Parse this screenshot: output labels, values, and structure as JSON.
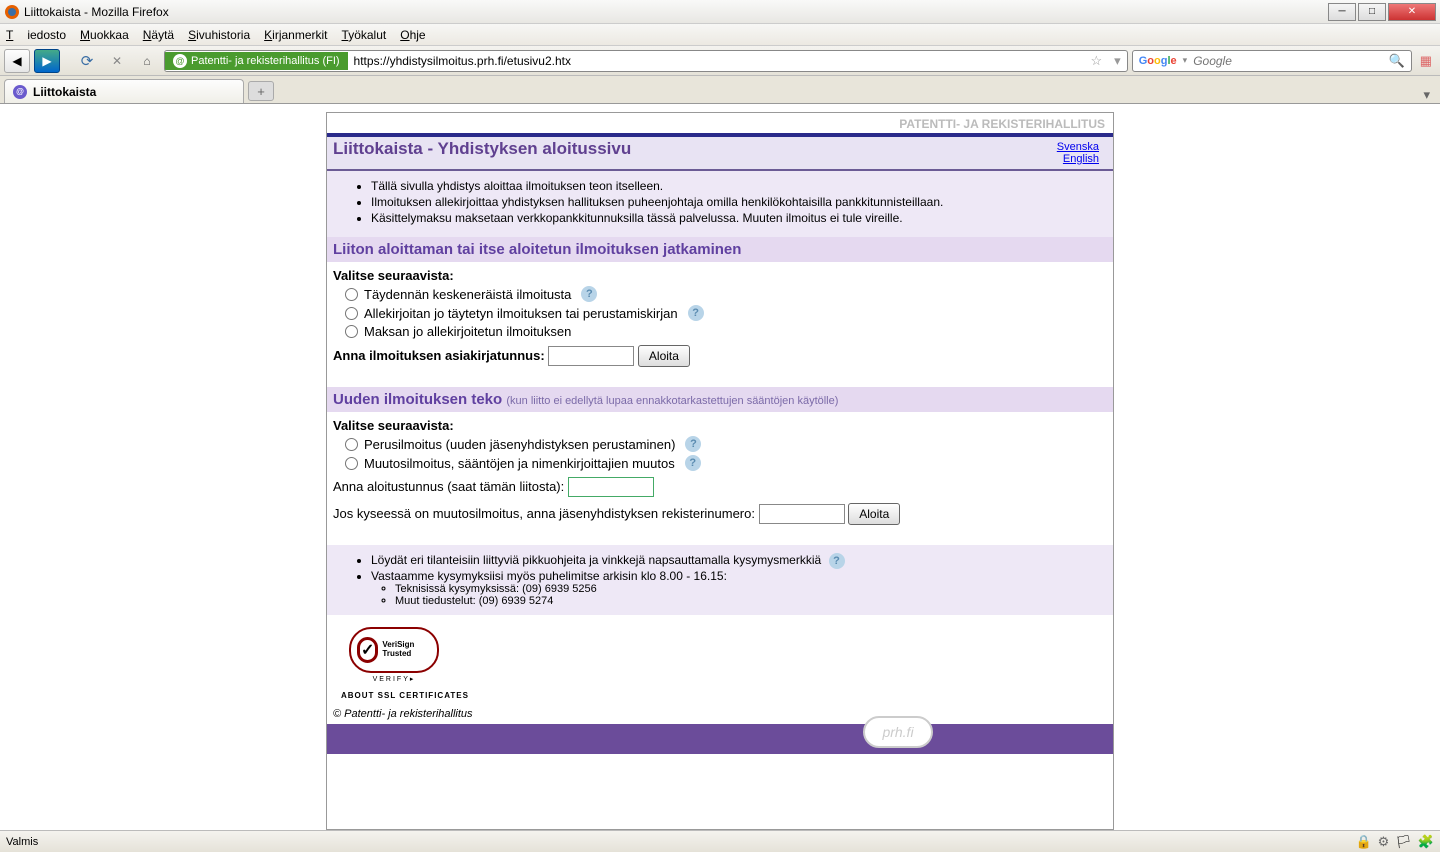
{
  "window": {
    "title": "Liittokaista - Mozilla Firefox"
  },
  "menu": {
    "items": [
      "Tiedosto",
      "Muokkaa",
      "Näytä",
      "Sivuhistoria",
      "Kirjanmerkit",
      "Työkalut",
      "Ohje"
    ]
  },
  "urlbar": {
    "identity": "Patentti- ja rekisterihallitus (FI)",
    "url": "https://yhdistysilmoitus.prh.fi/etusivu2.htx"
  },
  "searchbox": {
    "placeholder": "Google"
  },
  "tab": {
    "title": "Liittokaista"
  },
  "page": {
    "brand": "PATENTTI- JA REKISTERIHALLITUS",
    "title": "Liittokaista - Yhdistyksen aloitussivu",
    "lang_sv": "Svenska",
    "lang_en": "English",
    "intro": [
      "Tällä sivulla yhdistys aloittaa ilmoituksen teon itselleen.",
      "Ilmoituksen allekirjoittaa yhdistyksen hallituksen puheenjohtaja omilla henkilökohtaisilla pankkitunnisteillaan.",
      "Käsittelymaksu maksetaan verkkopankkitunnuksilla tässä palvelussa. Muuten ilmoitus ei tule vireille."
    ],
    "section1": {
      "title": "Liiton aloittaman tai itse aloitetun ilmoituksen jatkaminen",
      "choose": "Valitse seuraavista:",
      "opt1": "Täydennän keskeneräistä ilmoitusta",
      "opt2": "Allekirjoitan jo täytetyn ilmoituksen tai perustamiskirjan",
      "opt3": "Maksan jo allekirjoitetun ilmoituksen",
      "doc_id_label": "Anna ilmoituksen asiakirjatunnus:",
      "start": "Aloita"
    },
    "section2": {
      "title": "Uuden ilmoituksen teko",
      "subtitle": "(kun liitto ei edellytä lupaa ennakkotarkastettujen sääntöjen käytölle)",
      "choose": "Valitse seuraavista:",
      "opt1": "Perusilmoitus (uuden jäsenyhdistyksen perustaminen)",
      "opt2": "Muutosilmoitus, sääntöjen ja nimenkirjoittajien muutos",
      "start_code_label": "Anna aloitustunnus (saat tämän liitosta):",
      "reg_label": "Jos kyseessä on muutosilmoitus, anna jäsenyhdistyksen rekisterinumero:",
      "start": "Aloita"
    },
    "footer_info": {
      "tip": "Löydät eri tilanteisiin liittyviä pikkuohjeita ja vinkkejä napsauttamalla kysymysmerkkiä",
      "phone": "Vastaamme kysymyksiisi myös puhelimitse arkisin klo 8.00 - 16.15:",
      "tech": "Teknisissä kysymyksissä: (09) 6939 5256",
      "other": "Muut tiedustelut: (09) 6939 5274"
    },
    "verisign": {
      "trusted": "VeriSign Trusted",
      "verify": "VERIFY▸",
      "about": "ABOUT SSL CERTIFICATES"
    },
    "copyright": "© Patentti- ja rekisterihallitus",
    "prh_logo": "prh.fi"
  },
  "status": {
    "text": "Valmis"
  }
}
